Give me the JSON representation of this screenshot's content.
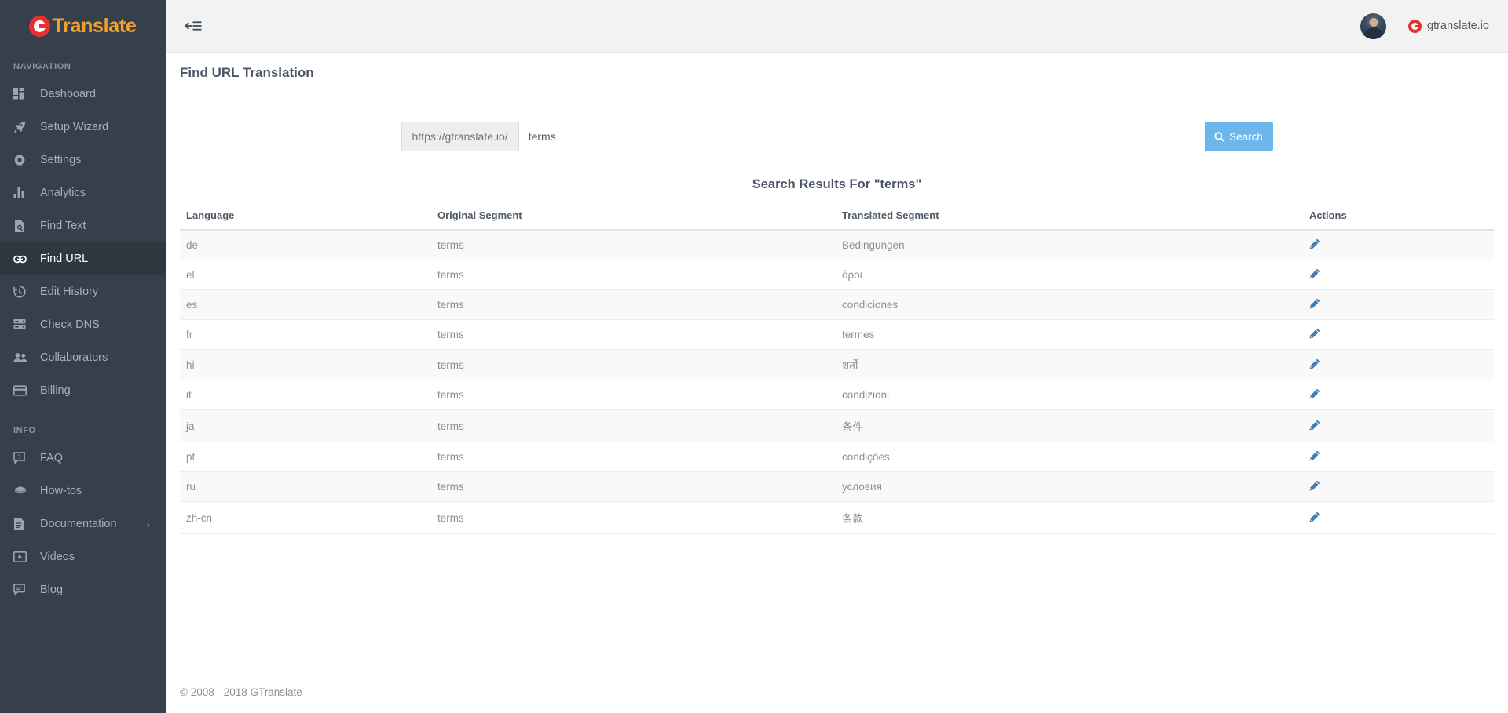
{
  "brand": {
    "name": "Translate",
    "logo_icon": "gtranslate-g-icon",
    "accent_color": "#f2a02a",
    "logo_color": "#e8312f"
  },
  "sidebar": {
    "background_color": "#36404a",
    "sections": [
      {
        "title": "NAVIGATION",
        "items": [
          {
            "label": "Dashboard",
            "icon": "dashboard-grid-icon",
            "active": false,
            "has_submenu": false
          },
          {
            "label": "Setup Wizard",
            "icon": "rocket-icon",
            "active": false,
            "has_submenu": false
          },
          {
            "label": "Settings",
            "icon": "gear-icon",
            "active": false,
            "has_submenu": false
          },
          {
            "label": "Analytics",
            "icon": "bar-chart-icon",
            "active": false,
            "has_submenu": false
          },
          {
            "label": "Find Text",
            "icon": "document-search-icon",
            "active": false,
            "has_submenu": false
          },
          {
            "label": "Find URL",
            "icon": "link-icon",
            "active": true,
            "has_submenu": false
          },
          {
            "label": "Edit History",
            "icon": "clock-history-icon",
            "active": false,
            "has_submenu": false
          },
          {
            "label": "Check DNS",
            "icon": "server-icon",
            "active": false,
            "has_submenu": false
          },
          {
            "label": "Collaborators",
            "icon": "people-icon",
            "active": false,
            "has_submenu": false
          },
          {
            "label": "Billing",
            "icon": "credit-card-icon",
            "active": false,
            "has_submenu": false
          }
        ]
      },
      {
        "title": "INFO",
        "items": [
          {
            "label": "FAQ",
            "icon": "question-bubble-icon",
            "active": false,
            "has_submenu": false
          },
          {
            "label": "How-tos",
            "icon": "graduation-cap-icon",
            "active": false,
            "has_submenu": false
          },
          {
            "label": "Documentation",
            "icon": "document-icon",
            "active": false,
            "has_submenu": true,
            "caret": "›"
          },
          {
            "label": "Videos",
            "icon": "video-play-icon",
            "active": false,
            "has_submenu": false
          },
          {
            "label": "Blog",
            "icon": "comment-lines-icon",
            "active": false,
            "has_submenu": false
          }
        ]
      }
    ]
  },
  "topbar": {
    "collapse_icon": "collapse-sidebar-icon",
    "avatar_icon": "user-avatar",
    "site_name": "gtranslate.io",
    "site_logo_icon": "gtranslate-g-icon"
  },
  "page": {
    "title": "Find URL Translation"
  },
  "search": {
    "url_prefix": "https://gtranslate.io/",
    "value": "terms",
    "placeholder": "",
    "button_label": "Search",
    "button_icon": "search-icon",
    "button_color": "#6cb6ec"
  },
  "results": {
    "title": "Search Results For \"terms\"",
    "columns": [
      "Language",
      "Original Segment",
      "Translated Segment",
      "Actions"
    ],
    "action_icon": "edit-pencil-icon",
    "action_icon_color": "#3e7cb1",
    "rows": [
      {
        "language": "de",
        "original": "terms",
        "translated": "Bedingungen"
      },
      {
        "language": "el",
        "original": "terms",
        "translated": "όροι"
      },
      {
        "language": "es",
        "original": "terms",
        "translated": "condiciones"
      },
      {
        "language": "fr",
        "original": "terms",
        "translated": "termes"
      },
      {
        "language": "hi",
        "original": "terms",
        "translated": "शर्तों"
      },
      {
        "language": "it",
        "original": "terms",
        "translated": "condizioni"
      },
      {
        "language": "ja",
        "original": "terms",
        "translated": "条件"
      },
      {
        "language": "pt",
        "original": "terms",
        "translated": "condições"
      },
      {
        "language": "ru",
        "original": "terms",
        "translated": "условия"
      },
      {
        "language": "zh-cn",
        "original": "terms",
        "translated": "条款"
      }
    ]
  },
  "footer": {
    "copyright": "© 2008 - 2018 GTranslate"
  }
}
